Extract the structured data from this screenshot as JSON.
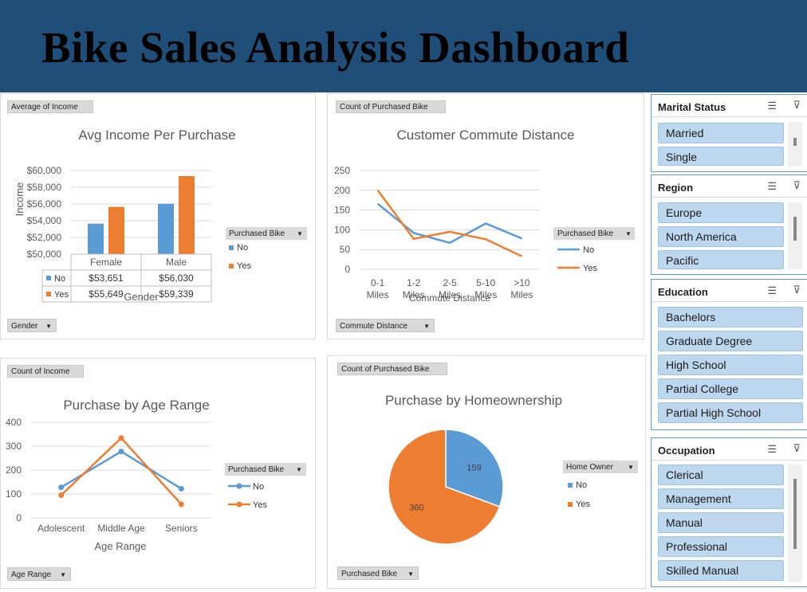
{
  "title": "Bike Sales Analysis Dashboard",
  "colors": {
    "no": "#5b9bd5",
    "yes": "#ed7d31",
    "header": "#1f4e79",
    "slicer_item": "#bdd7ee"
  },
  "income_chart": {
    "field_tag": "Average of Income",
    "axis_button": "Gender",
    "legend_button": "Purchased Bike",
    "chart_data": {
      "type": "bar",
      "title": "Avg Income Per Purchase",
      "xlabel": "Gender",
      "ylabel": "Income",
      "categories": [
        "Female",
        "Male"
      ],
      "series": [
        {
          "name": "No",
          "values": [
            53651,
            56030
          ]
        },
        {
          "name": "Yes",
          "values": [
            55649,
            59339
          ]
        }
      ],
      "ylim": [
        50000,
        60000
      ],
      "yticks": [
        "$50,000",
        "$52,000",
        "$54,000",
        "$56,000",
        "$58,000",
        "$60,000"
      ],
      "table": [
        {
          "name": "No",
          "cells": [
            "$53,651",
            "$56,030"
          ]
        },
        {
          "name": "Yes",
          "cells": [
            "$55,649",
            "$59,339"
          ]
        }
      ],
      "legend": [
        "No",
        "Yes"
      ]
    }
  },
  "commute_chart": {
    "field_tag": "Count of Purchased Bike",
    "axis_button": "Commute Distance",
    "legend_button": "Purchased Bike",
    "chart_data": {
      "type": "line",
      "title": "Customer Commute Distance",
      "xlabel": "Commute Distance",
      "categories": [
        "0-1 Miles",
        "1-2 Miles",
        "2-5 Miles",
        "5-10 Miles",
        ">10 Miles"
      ],
      "series": [
        {
          "name": "No",
          "values": [
            166,
            92,
            67,
            116,
            78
          ]
        },
        {
          "name": "Yes",
          "values": [
            200,
            77,
            95,
            76,
            33
          ]
        }
      ],
      "ylim": [
        0,
        250
      ],
      "yticks": [
        "0",
        "50",
        "100",
        "150",
        "200",
        "250"
      ],
      "legend": [
        "No",
        "Yes"
      ]
    }
  },
  "age_chart": {
    "field_tag": "Count of Income",
    "axis_button": "Age Range",
    "legend_button": "Purchased Bike",
    "chart_data": {
      "type": "line",
      "title": "Purchase by Age Range",
      "xlabel": "Age Range",
      "categories": [
        "Adolescent",
        "Middle Age",
        "Seniors"
      ],
      "series": [
        {
          "name": "No",
          "values": [
            128,
            278,
            122
          ]
        },
        {
          "name": "Yes",
          "values": [
            95,
            334,
            57
          ]
        }
      ],
      "ylim": [
        0,
        400
      ],
      "yticks": [
        "0",
        "100",
        "200",
        "300",
        "400"
      ],
      "legend": [
        "No",
        "Yes"
      ]
    }
  },
  "home_chart": {
    "field_tag": "Count of Purchased Bike",
    "axis_button": "Purchased Bike",
    "legend_button": "Home Owner",
    "chart_data": {
      "type": "pie",
      "title": "Purchase by Homeownership",
      "slices": [
        {
          "name": "No",
          "value": 159,
          "label": "159"
        },
        {
          "name": "Yes",
          "value": 360,
          "label": "360"
        }
      ],
      "legend": [
        "No",
        "Yes"
      ]
    }
  },
  "slicers": {
    "marital": {
      "title": "Marital Status",
      "items": [
        "Married",
        "Single"
      ]
    },
    "region": {
      "title": "Region",
      "items": [
        "Europe",
        "North America",
        "Pacific"
      ]
    },
    "education": {
      "title": "Education",
      "items": [
        "Bachelors",
        "Graduate Degree",
        "High School",
        "Partial College",
        "Partial High School"
      ]
    },
    "occupation": {
      "title": "Occupation",
      "items": [
        "Clerical",
        "Management",
        "Manual",
        "Professional",
        "Skilled Manual"
      ]
    }
  },
  "icons": {
    "multiselect": "multi-select-icon",
    "clear": "clear-filter-icon"
  }
}
